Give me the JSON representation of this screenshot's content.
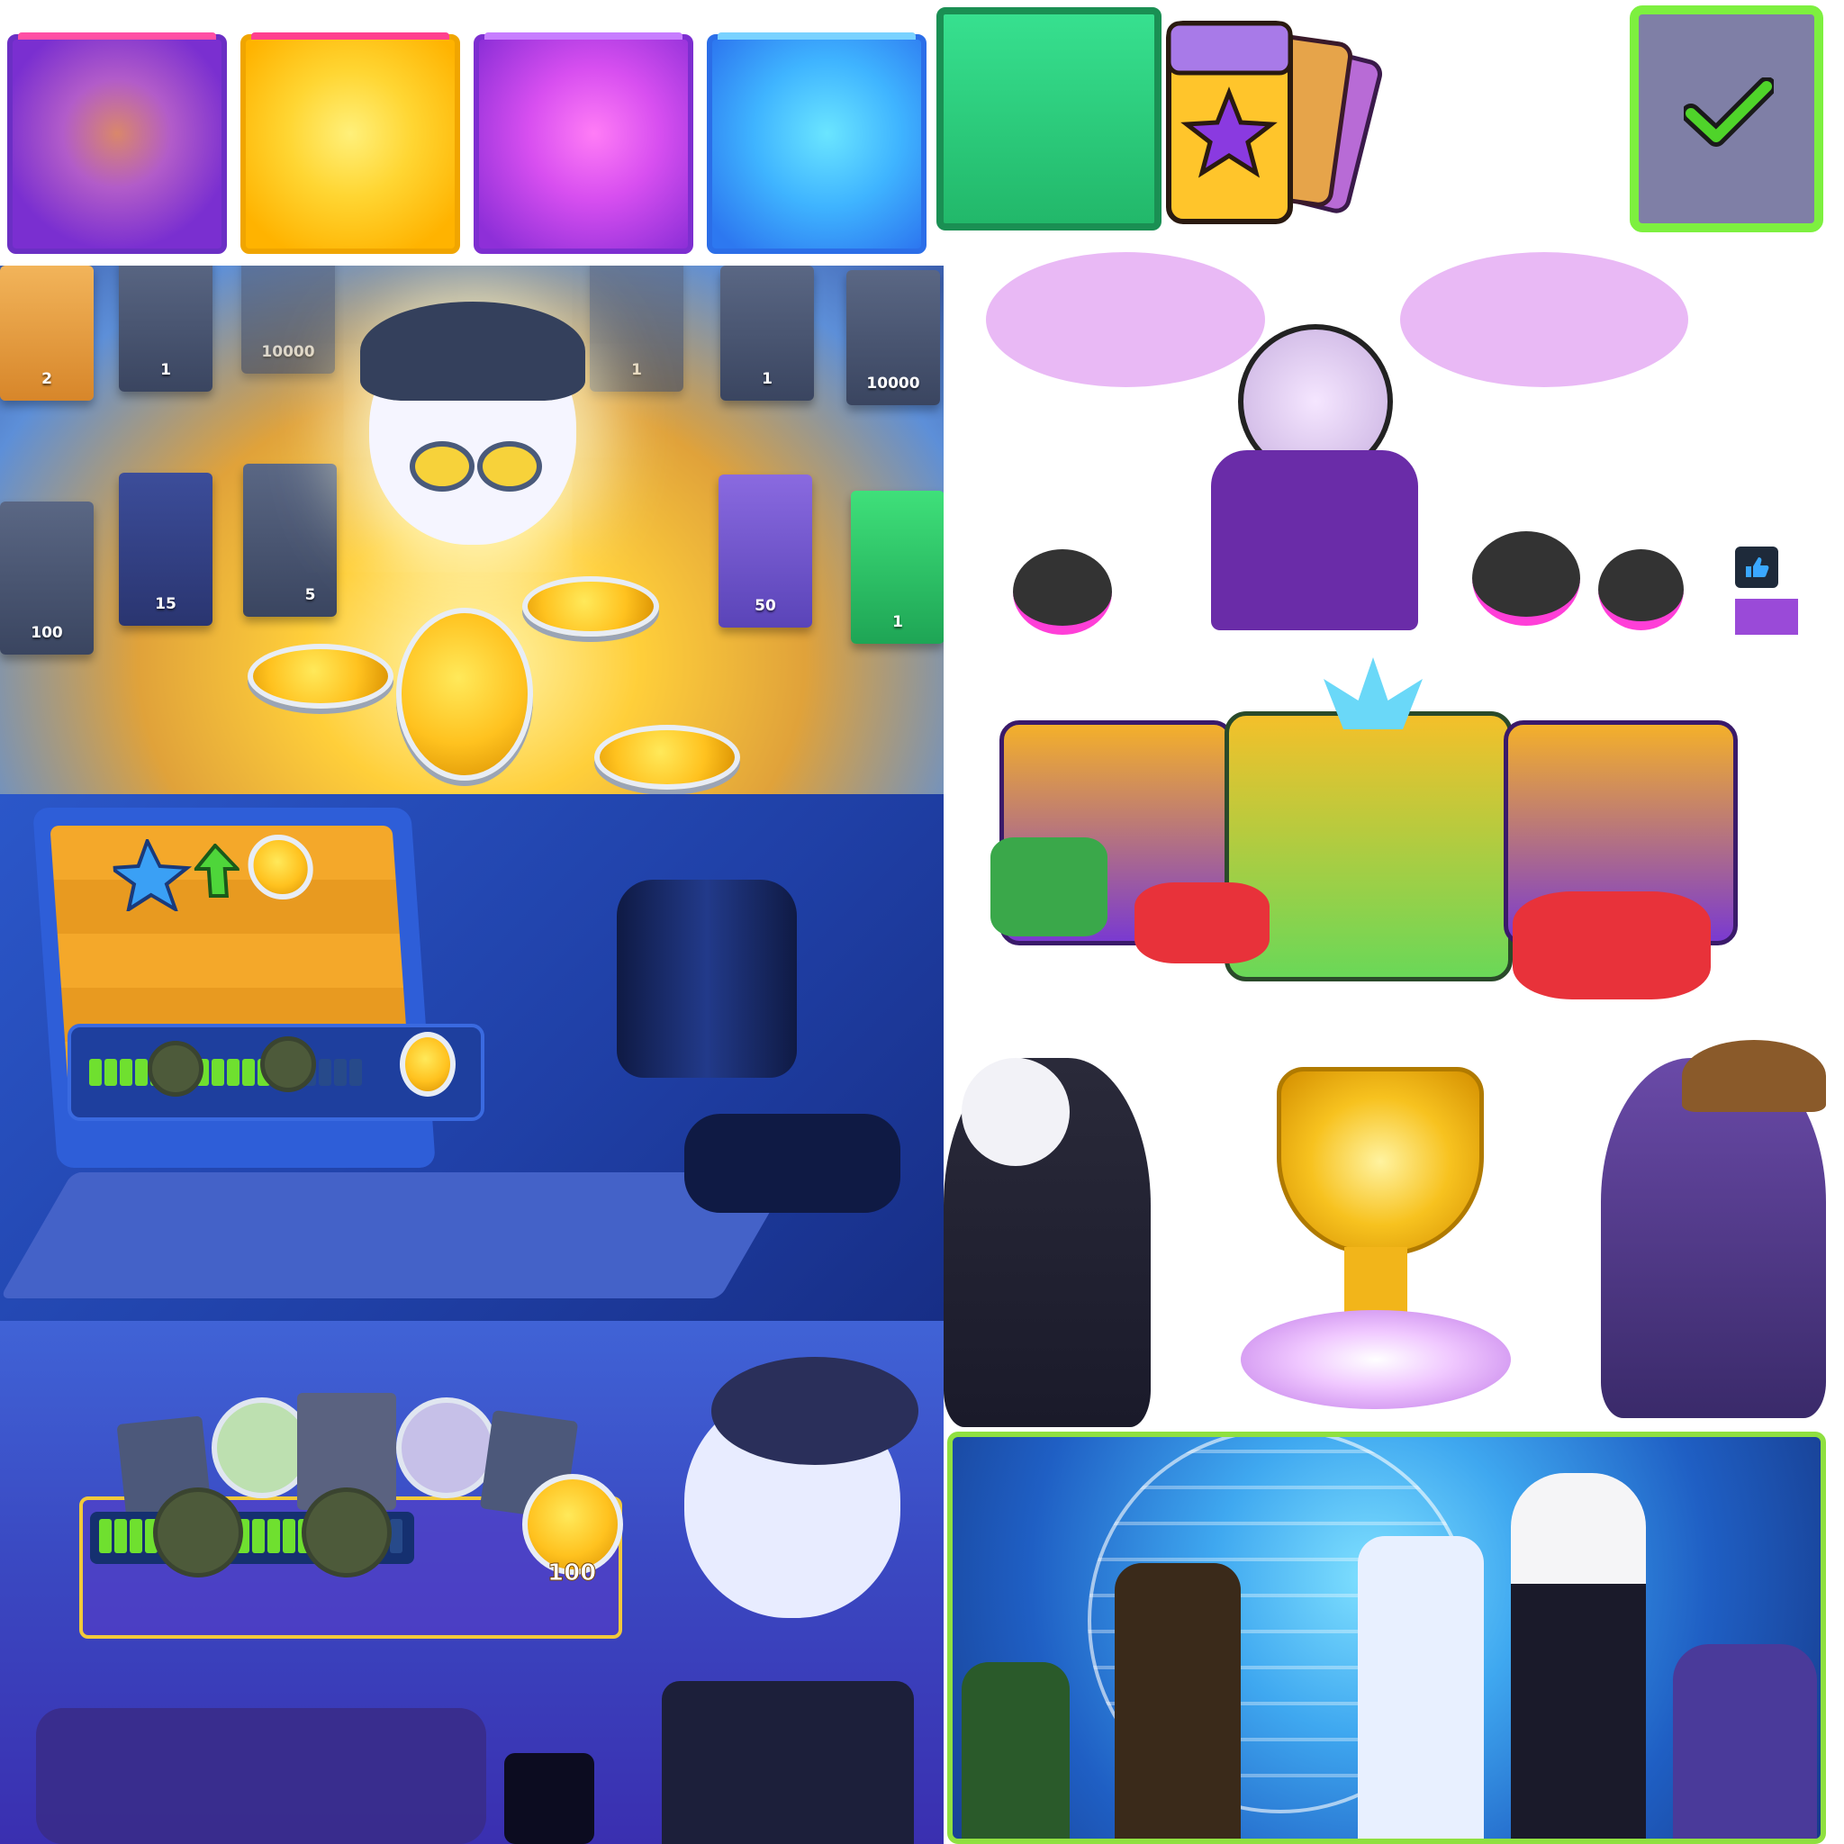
{
  "reward_cards": {
    "row1": [
      {
        "label": "2"
      },
      {
        "label": "1"
      },
      {
        "label": "10000"
      },
      {
        "label": "1"
      },
      {
        "label": "1"
      },
      {
        "label": "10000"
      }
    ],
    "row2": [
      {
        "label": "100"
      },
      {
        "label": "15"
      },
      {
        "label": "5"
      },
      {
        "label": "50"
      },
      {
        "label": "1"
      }
    ]
  },
  "progress_reward": {
    "amount": "100"
  },
  "colors": {
    "accent_green": "#7df03f",
    "gold": "#ffc21f",
    "purple": "#7a2fd0"
  }
}
